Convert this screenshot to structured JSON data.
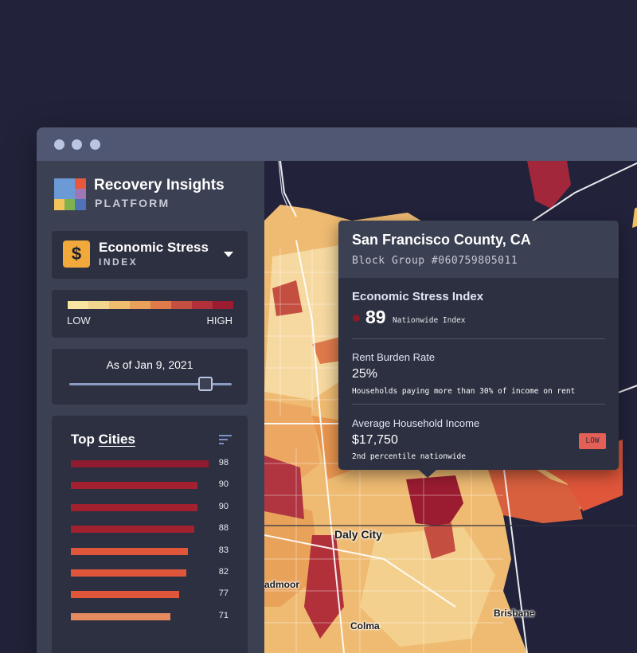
{
  "brand": {
    "title": "Recovery Insights",
    "subtitle": "PLATFORM"
  },
  "index_selector": {
    "title": "Economic Stress",
    "subtitle": "INDEX",
    "icon": "dollar-icon",
    "symbol": "$"
  },
  "legend": {
    "low": "LOW",
    "high": "HIGH",
    "colors": [
      "#f8e4a0",
      "#f2d68f",
      "#eebd6e",
      "#e8a05a",
      "#df7a4b",
      "#c44e3f",
      "#b1303a",
      "#9b1c31"
    ]
  },
  "date_slider": {
    "label": "As of Jan 9, 2021",
    "position": 0.84
  },
  "top_cities": {
    "title_prefix": "Top ",
    "title_link": "Cities",
    "items": [
      {
        "value": 98,
        "color": "#8e1b30"
      },
      {
        "value": 90,
        "color": "#a3202f"
      },
      {
        "value": 90,
        "color": "#a3202f"
      },
      {
        "value": 88,
        "color": "#a3202f"
      },
      {
        "value": 83,
        "color": "#e0563a"
      },
      {
        "value": 82,
        "color": "#e0563a"
      },
      {
        "value": 77,
        "color": "#e0563a"
      },
      {
        "value": 71,
        "color": "#e48a5e"
      }
    ]
  },
  "tooltip": {
    "county": "San Francisco County, CA",
    "block_group": "Block Group #060759805011",
    "section_title": "Economic Stress Index",
    "score": "89",
    "score_note": "Nationwide Index",
    "rent_label": "Rent Burden Rate",
    "rent_value": "25%",
    "rent_note": "Households paying more than 30% of income on rent",
    "income_label": "Average Household Income",
    "income_value": "$17,750",
    "income_note": "2nd percentile nationwide",
    "income_badge": "LOW"
  },
  "map": {
    "labels": {
      "daly_city": "Daly City",
      "colma": "Colma",
      "brisbane": "Brisbane",
      "admoor": "admoor"
    }
  }
}
